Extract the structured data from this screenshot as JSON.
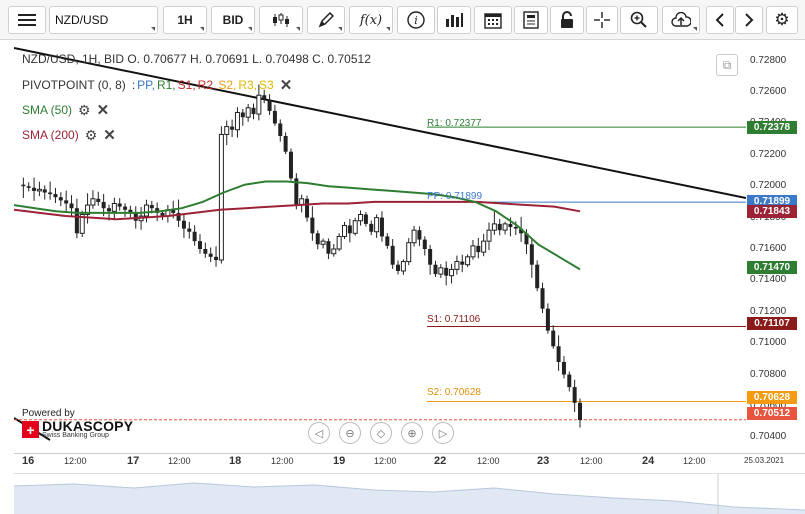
{
  "toolbar": {
    "symbol": "NZD/USD",
    "period": "1H",
    "side": "BID",
    "fx_label": "f(x)",
    "icons": [
      "menu-icon",
      "candlestick-icon",
      "pencil-icon",
      "function-icon",
      "info-icon",
      "bar-chart-icon",
      "calendar-icon",
      "document-icon",
      "lock-icon",
      "crosshair-icon",
      "zoom-icon",
      "upload-icon",
      "chevron-left-icon",
      "chevron-right-icon",
      "gear-icon"
    ]
  },
  "legend": {
    "ohlc": "NZD/USD, 1H, BID   O. 0.70677 H. 0.70691 L. 0.70498 C. 0.70512",
    "pivot_name": "PIVOTPOINT (0, 8)",
    "pivot_sep": ":",
    "pivot_items": [
      {
        "label": "PP,",
        "color": "#3a78c8"
      },
      {
        "label": "R1,",
        "color": "#2e7d32"
      },
      {
        "label": "S1,",
        "color": "#c62828"
      },
      {
        "label": "R2,",
        "color": "#c62828"
      },
      {
        "label": "S2,",
        "color": "#f39c12"
      },
      {
        "label": "R3,",
        "color": "#f1c40f"
      },
      {
        "label": "S3",
        "color": "#f1c40f"
      }
    ],
    "sma50": "SMA (50)",
    "sma200": "SMA (200)",
    "sma50_color": "#2e7d32",
    "sma200_color": "#9b2335"
  },
  "lines": {
    "r1": "R1: 0.72377",
    "pp": "PP: 0.71899",
    "s1": "S1: 0.71106",
    "s2": "S2: 0.70628"
  },
  "price_tags": {
    "r1": "0.72378",
    "pp": "0.71899",
    "sma200": "0.71843",
    "sma50": "0.71470",
    "s1": "0.71107",
    "s2": "0.70628",
    "last": "0.70512"
  },
  "price_ticks": [
    "0.72800",
    "0.72600",
    "0.72400",
    "0.72200",
    "0.72000",
    "0.71800",
    "0.71600",
    "0.71400",
    "0.71200",
    "0.71000",
    "0.70800",
    "0.70600",
    "0.70400"
  ],
  "time_ticks": [
    "16",
    "12:00",
    "17",
    "12:00",
    "18",
    "12:00",
    "19",
    "12:00",
    "22",
    "12:00",
    "23",
    "12:00",
    "24",
    "12:00",
    "25.03.2021"
  ],
  "branding": {
    "powered": "Powered by",
    "name": "DUKASCOPY",
    "sub": "Swiss Banking Group"
  },
  "colors": {
    "r1": "#2e7d32",
    "pp": "#3a78c8",
    "s1": "#8b1a1a",
    "s2": "#f39c12",
    "last": "#e8553f",
    "sma50": "#2e7d32",
    "sma200": "#9b2335",
    "candle": "#222222"
  },
  "chart_data": {
    "type": "candlestick",
    "symbol": "NZD/USD",
    "interval": "1H",
    "ohlc_last": {
      "open": 0.70677,
      "high": 0.70691,
      "low": 0.70498,
      "close": 0.70512
    },
    "ylim": [
      0.703,
      0.729
    ],
    "pivots": {
      "R1": 0.72377,
      "PP": 0.71899,
      "S1": 0.71106,
      "S2": 0.70628
    },
    "close_path": [
      0.7201,
      0.72,
      0.7199,
      0.7197,
      0.7198,
      0.7196,
      0.7195,
      0.7193,
      0.7191,
      0.7189,
      0.7186,
      0.717,
      0.7182,
      0.7188,
      0.7192,
      0.719,
      0.7186,
      0.7184,
      0.7189,
      0.7187,
      0.7185,
      0.7183,
      0.7178,
      0.7181,
      0.7188,
      0.7186,
      0.7183,
      0.7181,
      0.7185,
      0.7183,
      0.7178,
      0.7173,
      0.7171,
      0.7165,
      0.716,
      0.7157,
      0.7155,
      0.7153,
      0.7233,
      0.7238,
      0.7236,
      0.7247,
      0.7244,
      0.725,
      0.7246,
      0.7258,
      0.7255,
      0.7248,
      0.724,
      0.7232,
      0.7222,
      0.7205,
      0.7188,
      0.7192,
      0.718,
      0.717,
      0.7163,
      0.7165,
      0.7157,
      0.716,
      0.7168,
      0.7175,
      0.717,
      0.7178,
      0.7182,
      0.7176,
      0.7171,
      0.718,
      0.7168,
      0.7162,
      0.715,
      0.7146,
      0.7152,
      0.7164,
      0.7172,
      0.7166,
      0.716,
      0.715,
      0.7144,
      0.7148,
      0.7143,
      0.7147,
      0.7152,
      0.715,
      0.7155,
      0.7162,
      0.7158,
      0.7165,
      0.7172,
      0.7176,
      0.7172,
      0.7176,
      0.7174,
      0.7173,
      0.717,
      0.7163,
      0.715,
      0.7135,
      0.7122,
      0.7108,
      0.7098,
      0.7088,
      0.708,
      0.7072,
      0.7062,
      0.7051
    ],
    "sma50_path": [
      0.7188,
      0.7186,
      0.7184,
      0.7183,
      0.7183,
      0.7183,
      0.7183,
      0.7184,
      0.7186,
      0.719,
      0.7196,
      0.7201,
      0.7203,
      0.7203,
      0.7202,
      0.72,
      0.7199,
      0.7198,
      0.7197,
      0.7196,
      0.7195,
      0.7193,
      0.719,
      0.7184,
      0.7175,
      0.7163,
      0.7155,
      0.7147
    ],
    "sma200_path": [
      0.7185,
      0.7183,
      0.7181,
      0.718,
      0.7179,
      0.718,
      0.7181,
      0.7183,
      0.7185,
      0.7186,
      0.7187,
      0.7188,
      0.7189,
      0.7189,
      0.719,
      0.719,
      0.719,
      0.719,
      0.719,
      0.7189,
      0.7188,
      0.7187,
      0.7184
    ]
  }
}
